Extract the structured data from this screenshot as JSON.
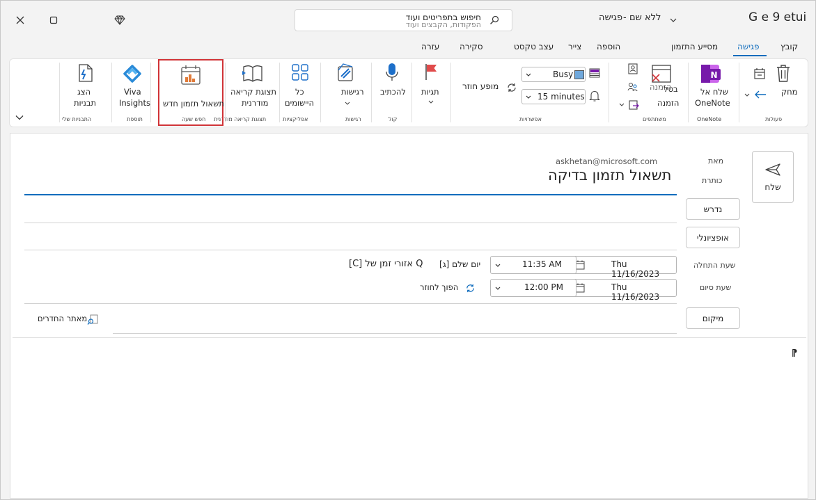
{
  "window": {
    "title_left": "G e 9 etui",
    "title_subject": "ללא שם",
    "title_sep": "-",
    "title_type": "פגישה",
    "search_placeholder": "חיפוש בתפריטים ועוד",
    "search_placeholder_faded": "הפקודות, הקבצים ועוד",
    "controls": {
      "close": "close-icon",
      "maximize": "maximize-icon",
      "premium": "diamond-icon"
    }
  },
  "tabs": [
    {
      "label": "קובץ"
    },
    {
      "label": "פגישה",
      "active": true
    },
    {
      "label": "מסייע התזמון"
    },
    {
      "label": "הוספה"
    },
    {
      "label": "צייר"
    },
    {
      "label": "עצב טקסט"
    },
    {
      "label": "סקירה"
    },
    {
      "label": "עזרה"
    }
  ],
  "ribbon": {
    "delete_label": "מחק",
    "forward_icon": "arrow-left-icon",
    "actions_group": "פעולות",
    "onenote_label_1": "שלח אל",
    "onenote_label_2": "OneNote",
    "onenote_group": "OneNote",
    "cancel_label_1": "בטל",
    "cancel_label_2": "הזמנה",
    "cancel_overlay": "הזמנה",
    "participants_group": "משתתפים",
    "busy_value": "Busy",
    "reminder_value": "15 minutes",
    "recurrence_label": "מופע חוזר",
    "options_group": "אפשרויות",
    "tags_label": "תגיות",
    "dictate_label": "להכתיב",
    "voice_group": "קול",
    "sensitivity_label": "רגישות",
    "sensitivity_group": "רגישות",
    "apps_label_1": "כל",
    "apps_label_2": "היישומים",
    "apps_group": "אפליקציות",
    "reader_label_1": "תצוגת קריאה",
    "reader_label_2": "מודרנית",
    "reader_group": "תצוגת קריאה מודרנית",
    "poll_label": "תשאול תזמון חדש",
    "poll_group": "חפש שעה",
    "viva_label_1": "Viva",
    "viva_label_2": "Insights",
    "addins_group": "תוספת",
    "templates_label_1": "הצג",
    "templates_label_2": "תבניות",
    "templates_group": "התבניות שלי",
    "highlight_color": "#d13438"
  },
  "form": {
    "send_label": "שלח",
    "from_label": "מאת",
    "from_value": "askhetan@microsoft.com",
    "title_label": "כותרת",
    "title_value": "תשאול תזמון בדיקה",
    "required_label": "נדרש",
    "optional_label": "אופציונלי",
    "start_label": "שעת התחלה",
    "start_date": "Thu 11/16/2023",
    "start_time": "11:35 AM",
    "allday_label": "[ג] יום שלם",
    "timezone_label": "[C] אזורי זמן של Q",
    "end_label": "שעת סיום",
    "end_date": "Thu 11/16/2023",
    "end_time": "12:00 PM",
    "recurring_label": "הפוך לחוזר",
    "location_label": "מיקום",
    "room_finder_label": "מאתר החדרים",
    "body_mark": "⁋"
  },
  "colors": {
    "accent": "#0f6cbd",
    "onenote": "#7719aa"
  }
}
